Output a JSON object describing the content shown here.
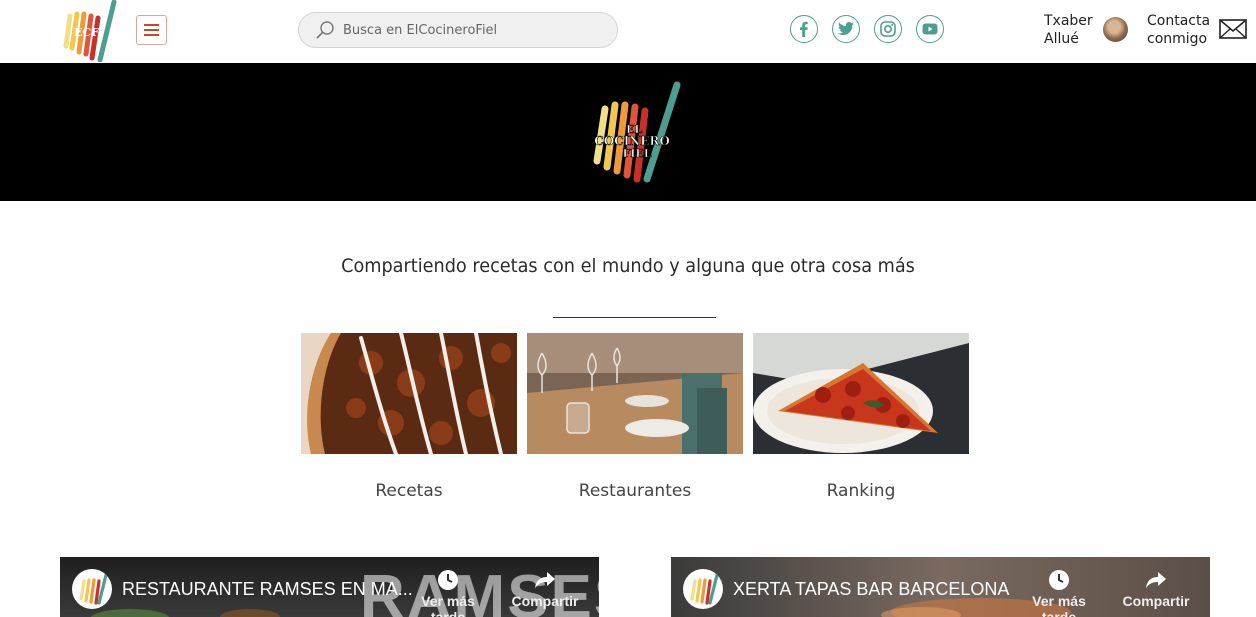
{
  "header": {
    "logo_alt": "ElCocineroFiel logo",
    "search": {
      "placeholder": "Busca en ElCocineroFiel",
      "value": ""
    },
    "socials": [
      "facebook-icon",
      "twitter-icon",
      "instagram-icon",
      "youtube-icon"
    ],
    "user_name": "Txaber Allué",
    "contact_label": "Contacta conmigo"
  },
  "hero": {
    "logo_text": "EL COCINERO FIEL"
  },
  "main": {
    "tagline": "Compartiendo recetas con el mundo y alguna que otra cosa más",
    "categories": [
      {
        "label": "Recetas"
      },
      {
        "label": "Restaurantes"
      },
      {
        "label": "Ranking"
      }
    ]
  },
  "videos": [
    {
      "title": "RESTAURANTE RAMSES EN MA...",
      "overlay_word": "RAMSES",
      "watch_later": "Ver más tarde",
      "share": "Compartir"
    },
    {
      "title": "XERTA TAPAS BAR BARCELONA",
      "watch_later": "Ver más tarde",
      "share": "Compartir"
    }
  ],
  "colors": {
    "accent_teal": "#4e9e8f",
    "accent_red": "#c9452f",
    "hero_bg": "#000000"
  }
}
